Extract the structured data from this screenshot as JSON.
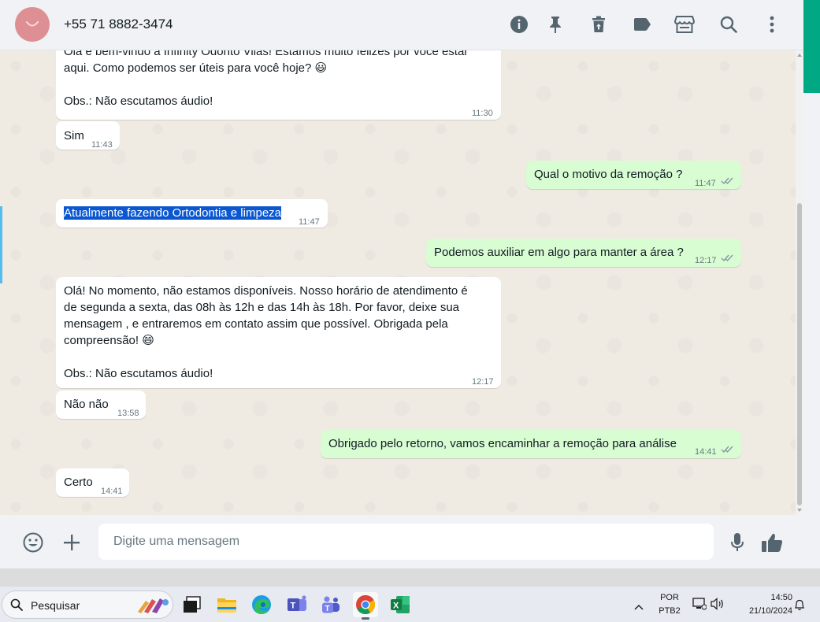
{
  "header": {
    "contact_name": "+55 71 8882-3474",
    "icons": [
      "info-icon",
      "pin-icon",
      "delete-icon",
      "label-icon",
      "store-icon",
      "search-icon",
      "menu-icon"
    ]
  },
  "messages": [
    {
      "direction": "in",
      "text": "Olá e bem-vindo à Infinity Odonto Vilas! Estamos muito felizes por você estar\naqui. Como podemos ser úteis para você hoje? 😃\n\nObs.: Não escutamos áudio!",
      "time": "11:30"
    },
    {
      "direction": "in",
      "text": "Sim",
      "time": "11:43"
    },
    {
      "direction": "out",
      "text": "Qual o motivo da remoção ?",
      "time": "11:47"
    },
    {
      "direction": "in",
      "text": "Atualmente fazendo Ortodontia e limpeza",
      "time": "11:47",
      "selected": true
    },
    {
      "direction": "out",
      "text": "Podemos auxiliar em algo para manter a área ?",
      "time": "12:17"
    },
    {
      "direction": "in",
      "text": "Olá! No momento, não estamos disponíveis. Nosso horário de atendimento é\nde segunda a sexta, das 08h às 12h e das 14h às 18h. Por favor, deixe sua\nmensagem , e entraremos em contato assim que possível. Obrigada pela\ncompreensão! 😄\n\nObs.: Não escutamos áudio!",
      "time": "12:17"
    },
    {
      "direction": "in",
      "text": "Não não",
      "time": "13:58"
    },
    {
      "direction": "out",
      "text": "Obrigado pelo retorno, vamos encaminhar a remoção para análise",
      "time": "14:41"
    },
    {
      "direction": "in",
      "text": "Certo",
      "time": "14:41"
    }
  ],
  "composer": {
    "placeholder": "Digite uma mensagem"
  },
  "taskbar": {
    "search_label": "Pesquisar",
    "language": "POR",
    "keyboard": "PTB2",
    "clock_time": "14:50",
    "clock_date": "21/10/2024"
  },
  "colors": {
    "accent": "#00a884",
    "outgoing_bubble": "#d9fdd3",
    "incoming_bubble": "#ffffff",
    "read_ticks": "#8696a0",
    "selection": "#0b57d0"
  }
}
